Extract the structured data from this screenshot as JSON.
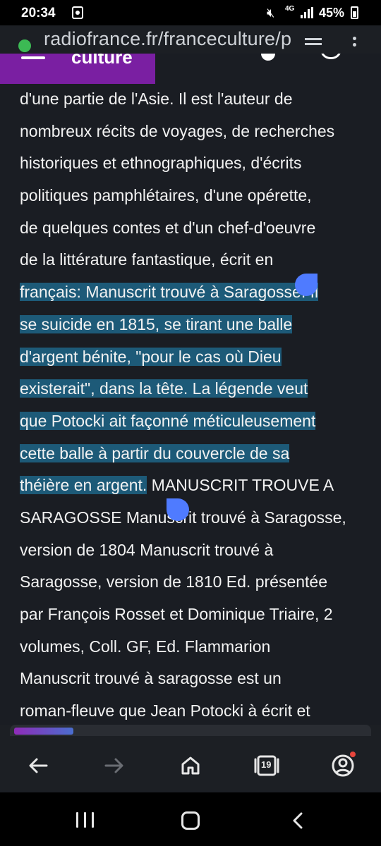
{
  "status_bar": {
    "time": "20:34",
    "network_type": "4G",
    "battery_percent": "45%",
    "icons": [
      "notification-icon",
      "mute-icon",
      "signal-icon",
      "battery-icon"
    ]
  },
  "browser": {
    "url": "radiofrance.fr/franceculture/p",
    "site_name": "culture",
    "tab_count": "19"
  },
  "article": {
    "lines": [
      "d'une partie de l'Asie. Il est l'auteur de",
      "nombreux récits de voyages, de recherches",
      "historiques et ethnographiques, d'écrits",
      "politiques pamphlétaires, d'une opérette,",
      "de quelques contes et d'un chef-d'oeuvre",
      "de la littérature fantastique, écrit en"
    ],
    "selected_lines": [
      "français: Manuscrit trouvé à Saragosse. Il",
      "se suicide en 1815, se tirant une balle",
      "d'argent bénite, \"pour le cas où Dieu",
      "existerait\", dans la tête. La légende veut",
      "que Potocki ait façonné méticuleusement",
      "cette balle à partir du couvercle de sa"
    ],
    "selected_tail": "théière en argent.",
    "tail_rest": " MANUSCRIT TROUVE A",
    "lines_after": [
      "SARAGOSSE Manuscrit trouvé à Saragosse,",
      "version de 1804 Manuscrit trouvé à",
      "Saragosse, version de 1810 Ed. présentée",
      "par François Rosset et Dominique Triaire, 2",
      "volumes, Coll. GF, Ed. Flammarion",
      "Manuscrit trouvé à saragosse est un",
      "roman-fleuve que Jean Potocki à écrit et"
    ]
  },
  "colors": {
    "selection": "#1d5a78",
    "brand": "#7a1fa2",
    "handle": "#4f7bff"
  }
}
